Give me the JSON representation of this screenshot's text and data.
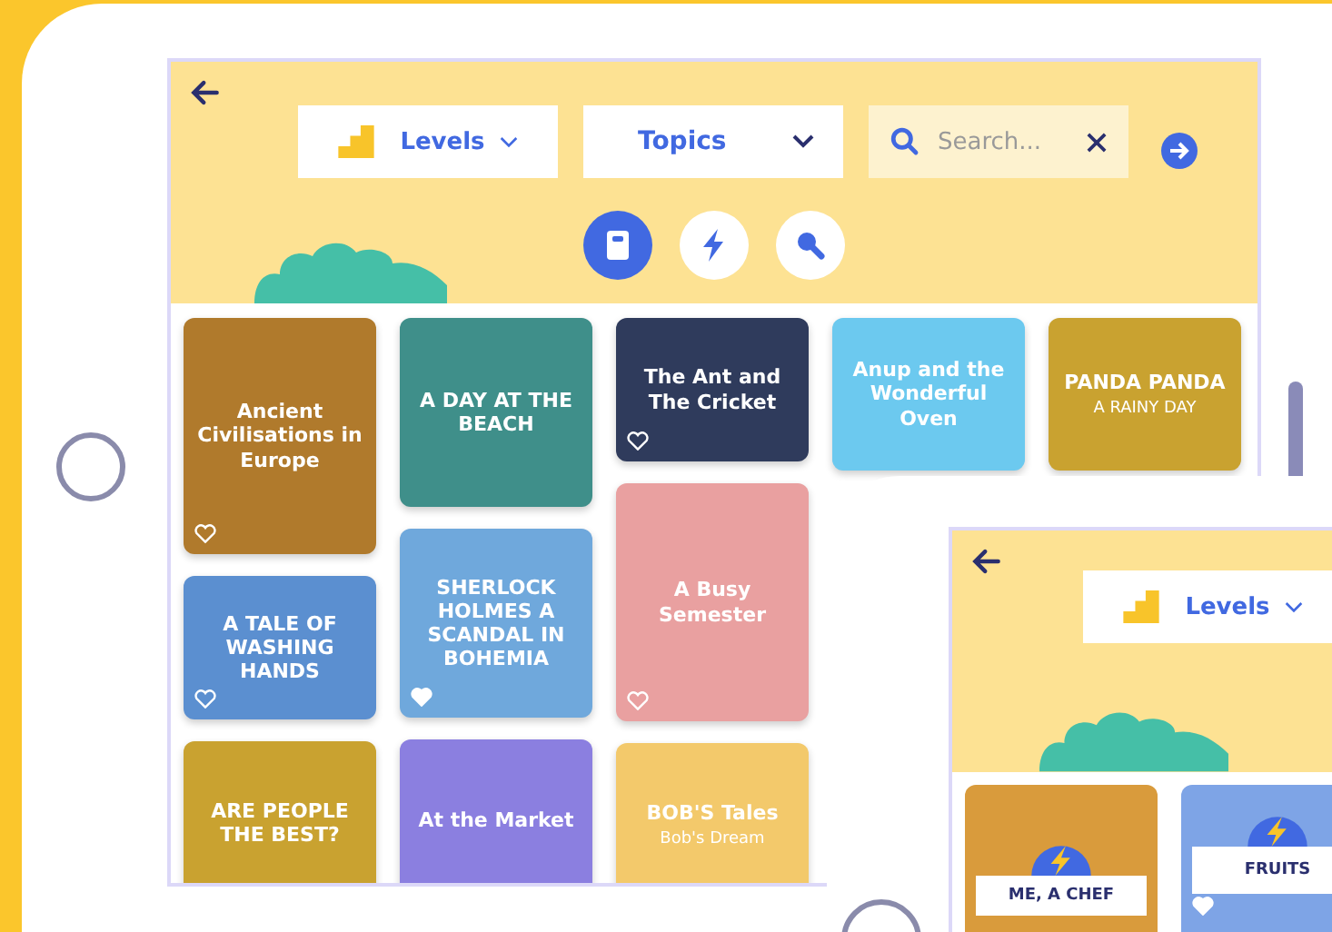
{
  "main_screen": {
    "filters": [
      {
        "kind": "levels",
        "label": "Levels"
      },
      {
        "kind": "topics",
        "label": "Topics"
      }
    ],
    "search": {
      "placeholder": "Search..."
    },
    "modes": [
      {
        "kind": "books",
        "selected": true
      },
      {
        "kind": "lightning",
        "selected": false
      },
      {
        "kind": "microphone",
        "selected": false
      }
    ],
    "book_columns": [
      {
        "books": [
          {
            "title": "Ancient Civilisations in Europe",
            "favorite": false
          },
          {
            "title": "A TALE OF WASHING HANDS",
            "favorite": false
          },
          {
            "title": "ARE PEOPLE THE BEST?"
          }
        ]
      },
      {
        "books": [
          {
            "title": "A DAY AT THE BEACH"
          },
          {
            "title": "SHERLOCK HOLMES A SCANDAL IN BOHEMIA",
            "favorite": true
          },
          {
            "title": "At the Market"
          }
        ]
      },
      {
        "books": [
          {
            "title": "The Ant and The Cricket",
            "favorite": false
          },
          {
            "title": "A Busy Semester",
            "favorite": false
          },
          {
            "title": "BOB'S Tales",
            "subtitle": "Bob's Dream"
          }
        ]
      },
      {
        "books": [
          {
            "title": "Anup and the Wonderful Oven"
          }
        ]
      },
      {
        "books": [
          {
            "title": "PANDA PANDA",
            "subtitle": "A RAINY DAY"
          }
        ]
      }
    ]
  },
  "second_screen": {
    "filters": [
      {
        "kind": "levels",
        "label": "Levels"
      }
    ],
    "books": [
      {
        "title": "ME, A CHEF"
      },
      {
        "title": "FRUITS",
        "favorite": true
      }
    ]
  }
}
